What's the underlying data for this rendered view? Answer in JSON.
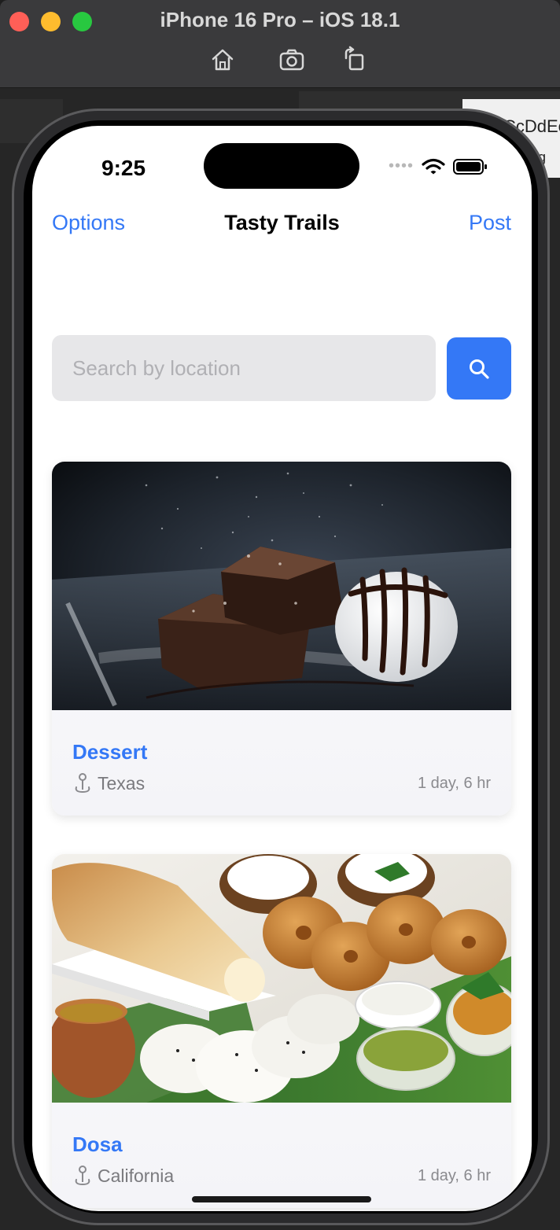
{
  "simulator": {
    "title": "iPhone 16 Pro – iOS 18.1",
    "tools": [
      "home-icon",
      "screenshot-icon",
      "rotate-icon"
    ]
  },
  "editor": {
    "snippet_1": "CcDdEe",
    "snippet_2": "ng"
  },
  "status_bar": {
    "time": "9:25",
    "icons": [
      "signal-dots",
      "wifi-icon",
      "battery-icon"
    ]
  },
  "nav": {
    "left": "Options",
    "title": "Tasty Trails",
    "right": "Post"
  },
  "search": {
    "placeholder": "Search by location",
    "value": "",
    "button_icon": "search-icon"
  },
  "posts": [
    {
      "title": "Dessert",
      "location": "Texas",
      "time": "1 day, 6 hr"
    },
    {
      "title": "Dosa",
      "location": "California",
      "time": "1 day, 6 hr"
    }
  ],
  "colors": {
    "accent": "#3478f6",
    "field": "#e7e7e9",
    "secondary_text": "#7a7a7e"
  }
}
